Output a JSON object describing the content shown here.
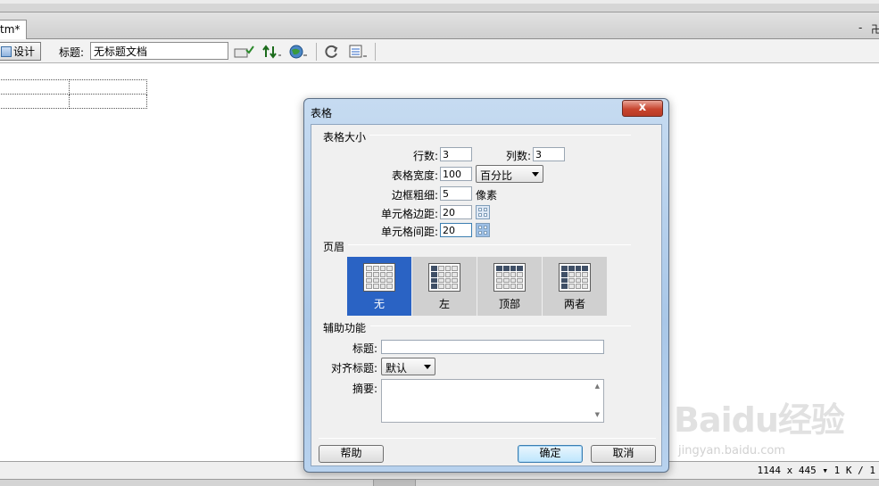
{
  "editor": {
    "doc_tab_label": "tm*",
    "window_controls": {
      "minimize": "-",
      "restore": "卍"
    },
    "toolbar": {
      "design_label": "设计",
      "title_label": "标题:",
      "title_value": "无标题文档"
    },
    "status_text": "1144 x 445 ▾ 1 K / 1"
  },
  "watermark": {
    "main": "Baidu经验",
    "sub": "jingyan.baidu.com"
  },
  "dialog": {
    "title": "表格",
    "close_label": "x",
    "size_section": {
      "title": "表格大小",
      "rows_label": "行数:",
      "rows_value": "3",
      "cols_label": "列数:",
      "cols_value": "3",
      "width_label": "表格宽度:",
      "width_value": "100",
      "width_unit": "百分比",
      "border_label": "边框粗细:",
      "border_value": "5",
      "border_unit": "像素",
      "padding_label": "单元格边距:",
      "padding_value": "20",
      "spacing_label": "单元格间距:",
      "spacing_value": "20"
    },
    "header_section": {
      "title": "页眉",
      "options": [
        {
          "label": "无",
          "selected": true
        },
        {
          "label": "左",
          "selected": false
        },
        {
          "label": "顶部",
          "selected": false
        },
        {
          "label": "两者",
          "selected": false
        }
      ]
    },
    "accessibility_section": {
      "title": "辅助功能",
      "caption_label": "标题:",
      "caption_value": "",
      "align_label": "对齐标题:",
      "align_value": "默认",
      "summary_label": "摘要:",
      "summary_value": ""
    },
    "buttons": {
      "help": "帮助",
      "ok": "确定",
      "cancel": "取消"
    }
  }
}
